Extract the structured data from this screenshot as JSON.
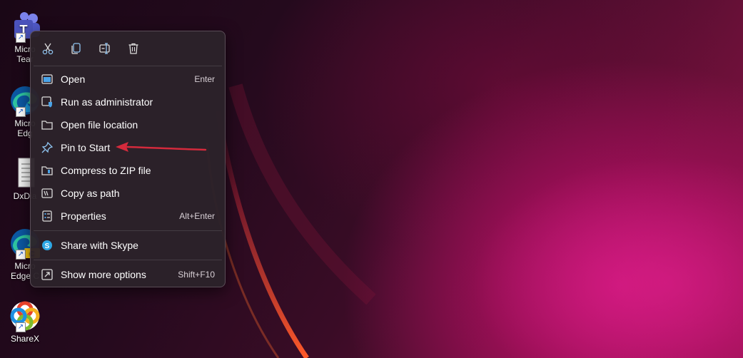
{
  "desktop": {
    "icons": [
      {
        "label": "Microsoft Teams",
        "icon": "teams-icon"
      },
      {
        "label": "Microsoft Edge",
        "icon": "edge-icon"
      },
      {
        "label": "DxDiag",
        "icon": "document-icon"
      },
      {
        "label": "Microsoft Edge Canary",
        "icon": "edge-canary-icon"
      },
      {
        "label": "ShareX",
        "icon": "sharex-icon"
      }
    ],
    "visible_labels": {
      "teams": [
        "Micro",
        "Tear"
      ],
      "edge": [
        "Micro",
        "Edg"
      ],
      "dxdiag": [
        "DxDia"
      ],
      "edge_canary": [
        "Micro",
        "Edge C"
      ],
      "sharex": [
        "ShareX"
      ]
    }
  },
  "context_menu": {
    "toolbar": [
      {
        "name": "cut",
        "icon": "scissors-icon"
      },
      {
        "name": "copy",
        "icon": "copy-icon"
      },
      {
        "name": "rename",
        "icon": "rename-icon"
      },
      {
        "name": "delete",
        "icon": "trash-icon"
      }
    ],
    "items": [
      {
        "label": "Open",
        "shortcut": "Enter",
        "icon": "open-window-icon"
      },
      {
        "label": "Run as administrator",
        "shortcut": "",
        "icon": "shield-window-icon"
      },
      {
        "label": "Open file location",
        "shortcut": "",
        "icon": "folder-icon"
      },
      {
        "label": "Pin to Start",
        "shortcut": "",
        "icon": "pin-icon"
      },
      {
        "label": "Compress to ZIP file",
        "shortcut": "",
        "icon": "zip-folder-icon"
      },
      {
        "label": "Copy as path",
        "shortcut": "",
        "icon": "copy-path-icon"
      },
      {
        "label": "Properties",
        "shortcut": "Alt+Enter",
        "icon": "properties-icon"
      },
      {
        "label": "Share with Skype",
        "shortcut": "",
        "icon": "skype-icon"
      },
      {
        "label": "Show more options",
        "shortcut": "Shift+F10",
        "icon": "more-options-icon"
      }
    ]
  },
  "annotation": {
    "arrow_color": "#d42a3c",
    "target": "Pin to Start"
  },
  "colors": {
    "menu_bg": "#2c222a",
    "accent_blue": "#4aa3e8",
    "wallpaper_magenta": "#c81478"
  }
}
